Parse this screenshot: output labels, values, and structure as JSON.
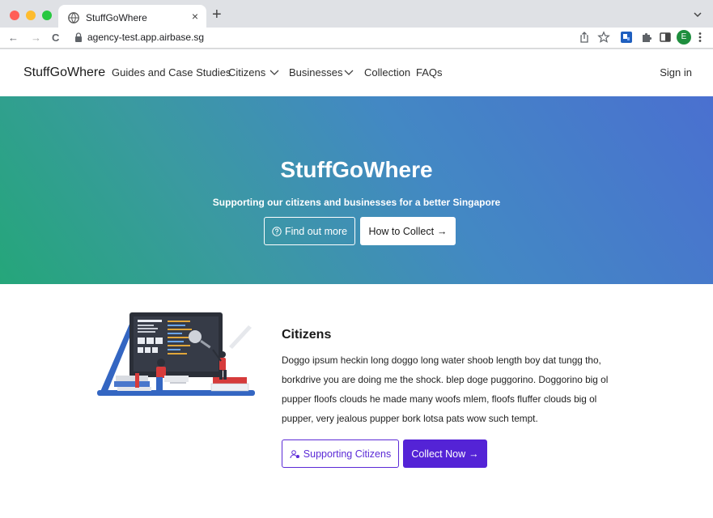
{
  "browser": {
    "tab_title": "StuffGoWhere",
    "tab_close": "×",
    "new_tab": "+",
    "url": "agency-test.app.airbase.sg",
    "profile_initial": "E",
    "nav_back": "←",
    "nav_forward": "→",
    "nav_reload": "C"
  },
  "site_nav": {
    "brand": "StuffGoWhere",
    "links": [
      "Guides and Case Studies",
      "Citizens",
      "Businesses",
      "Collection",
      "FAQs"
    ],
    "sign_in": "Sign in"
  },
  "hero": {
    "title": "StuffGoWhere",
    "subtitle": "Supporting our citizens and businesses for a better Singapore",
    "btn_find_out": "Find out more",
    "btn_how_to": "How to Collect",
    "arrow": "→",
    "gradient_start": "#25a67a",
    "gradient_end": "#4a70d0"
  },
  "citizens": {
    "title": "Citizens",
    "body": "Doggo ipsum heckin long doggo long water shoob length boy dat tungg tho, borkdrive you are doing me the shock. blep doge puggorino. Doggorino big ol pupper floofs clouds he made many woofs mlem, floofs fluffer clouds big ol pupper, very jealous pupper bork lotsa pats wow such tempt.",
    "btn_supporting": "Supporting Citizens",
    "btn_collect": "Collect Now",
    "arrow": "→",
    "accent": "#5423d6"
  },
  "icons": [
    "globe-icon",
    "lock-icon",
    "share-icon",
    "star-icon",
    "extension-icon",
    "puzzle-icon",
    "sidepanel-icon",
    "menu-dots-icon",
    "chevron-down-icon",
    "question-circle-icon",
    "users-icon",
    "arrow-right-icon"
  ]
}
